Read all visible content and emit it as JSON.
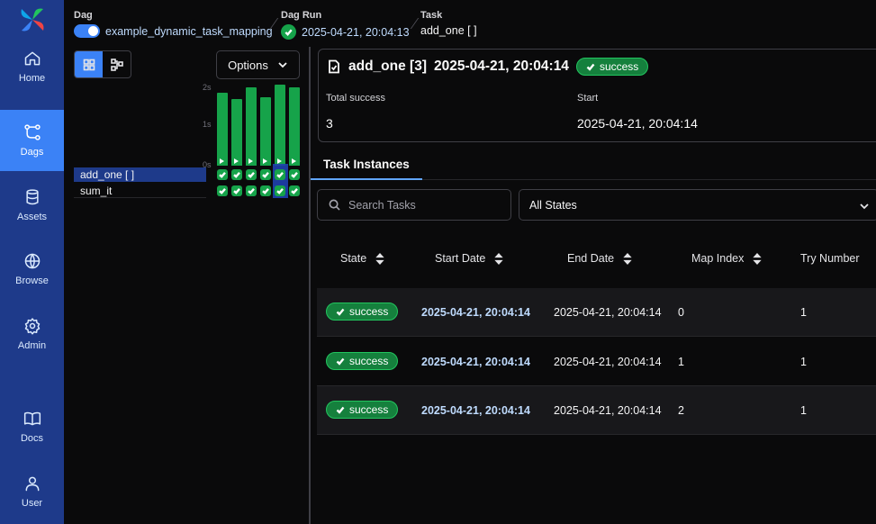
{
  "sidebar": {
    "logo": "airflow-pinwheel-logo",
    "items": [
      {
        "label": "Home",
        "icon": "home-icon"
      },
      {
        "label": "Dags",
        "icon": "dags-icon",
        "active": true
      },
      {
        "label": "Assets",
        "icon": "database-icon"
      },
      {
        "label": "Browse",
        "icon": "globe-icon"
      },
      {
        "label": "Admin",
        "icon": "gear-icon"
      },
      {
        "label": "Docs",
        "icon": "book-icon"
      },
      {
        "label": "User",
        "icon": "user-icon"
      }
    ]
  },
  "header": {
    "dag": {
      "title": "Dag",
      "value": "example_dynamic_task_mapping",
      "enabled": true
    },
    "dag_run": {
      "title": "Dag Run",
      "value": "2025-04-21, 20:04:13"
    },
    "task": {
      "title": "Task",
      "value": "add_one [ ]"
    }
  },
  "grid": {
    "options_label": "Options",
    "axis": [
      "2s",
      "1s",
      "0s"
    ],
    "run_durations_s": [
      1.77,
      1.6,
      1.9,
      1.65,
      1.95,
      1.9
    ],
    "tasks": [
      {
        "label": "add_one [ ]",
        "selected": true
      },
      {
        "label": "sum_it",
        "selected": false
      }
    ],
    "status_color": "#16a34a"
  },
  "summary": {
    "task_name": "add_one [3]",
    "date": "2025-04-21, 20:04:14",
    "state": "success",
    "total_success_label": "Total success",
    "total_success_value": "3",
    "start_label": "Start",
    "start_value": "2025-04-21, 20:04:14"
  },
  "tabs": [
    {
      "label": "Task Instances",
      "active": true
    }
  ],
  "filters": {
    "search_placeholder": "Search Tasks",
    "state_select": "All States"
  },
  "table": {
    "columns": [
      "State",
      "Start Date",
      "End Date",
      "Map Index",
      "Try Number"
    ],
    "rows": [
      {
        "state": "success",
        "start": "2025-04-21, 20:04:14",
        "end": "2025-04-21, 20:04:14",
        "map_index": "0",
        "try": "1"
      },
      {
        "state": "success",
        "start": "2025-04-21, 20:04:14",
        "end": "2025-04-21, 20:04:14",
        "map_index": "1",
        "try": "1"
      },
      {
        "state": "success",
        "start": "2025-04-21, 20:04:14",
        "end": "2025-04-21, 20:04:14",
        "map_index": "2",
        "try": "1"
      }
    ]
  }
}
